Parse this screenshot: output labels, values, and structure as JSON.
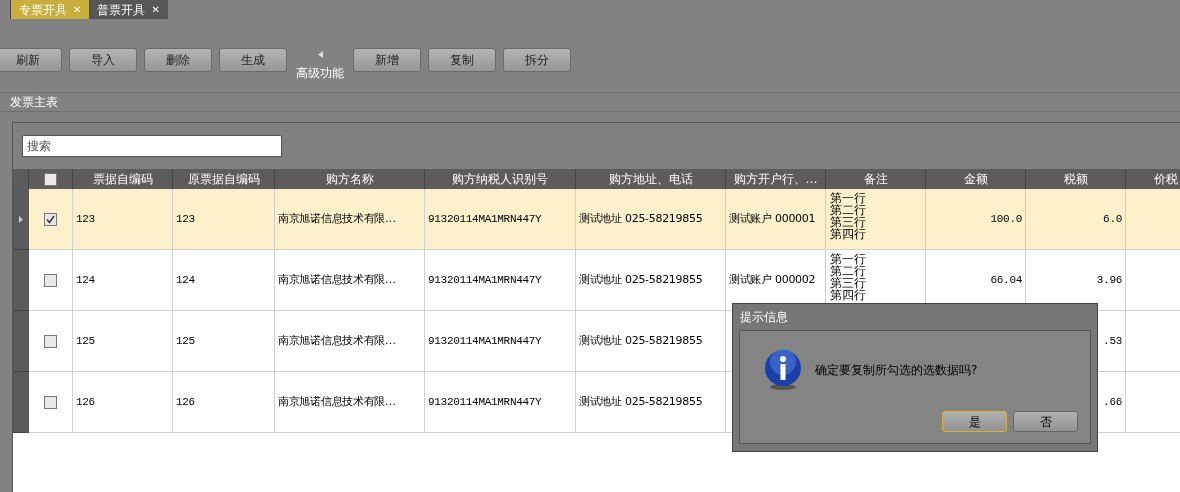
{
  "tabs": [
    {
      "label": "专票开具",
      "selected": true,
      "close": "✕"
    },
    {
      "label": "普票开具",
      "selected": false,
      "close": "✕"
    }
  ],
  "toolbar": {
    "buttons_left": [
      "刷新",
      "导入",
      "删除",
      "生成"
    ],
    "advanced_label": "高级功能",
    "buttons_right": [
      "新增",
      "复制",
      "拆分"
    ]
  },
  "section_title": "发票主表",
  "search": {
    "placeholder": "搜索"
  },
  "table": {
    "select_all_checked": false,
    "columns": [
      "票据自编码",
      "原票据自编码",
      "购方名称",
      "购方纳税人识别号",
      "购方地址、电话",
      "购方开户行、…",
      "备注",
      "金额",
      "税额",
      "价税"
    ],
    "rows": [
      {
        "selected": true,
        "checked": true,
        "code": "123",
        "orig_code": "123",
        "buyer": "南京旭诺信息技术有限…",
        "tax_id": "91320114MA1MRN447Y",
        "address": "测试地址 025-58219855",
        "bank": "测试账户 000001",
        "remarks": [
          "第一行",
          "第二行",
          "第三行",
          "第四行"
        ],
        "amount": "100.0",
        "tax": "6.0"
      },
      {
        "selected": false,
        "checked": false,
        "code": "124",
        "orig_code": "124",
        "buyer": "南京旭诺信息技术有限…",
        "tax_id": "91320114MA1MRN447Y",
        "address": "测试地址 025-58219855",
        "bank": "测试账户 000002",
        "remarks": [
          "第一行",
          "第二行",
          "第三行",
          "第四行"
        ],
        "amount": "66.04",
        "tax": "3.96"
      },
      {
        "selected": false,
        "checked": false,
        "code": "125",
        "orig_code": "125",
        "buyer": "南京旭诺信息技术有限…",
        "tax_id": "91320114MA1MRN447Y",
        "address": "测试地址 025-58219855",
        "tax": ".53"
      },
      {
        "selected": false,
        "checked": false,
        "code": "126",
        "orig_code": "126",
        "buyer": "南京旭诺信息技术有限…",
        "tax_id": "91320114MA1MRN447Y",
        "address": "测试地址 025-58219855",
        "tax": ".66"
      }
    ]
  },
  "dialog": {
    "title": "提示信息",
    "message": "确定要复制所勾选的选数据吗?",
    "buttons": [
      {
        "label": "是",
        "focused": true
      },
      {
        "label": "否",
        "focused": false
      }
    ]
  }
}
